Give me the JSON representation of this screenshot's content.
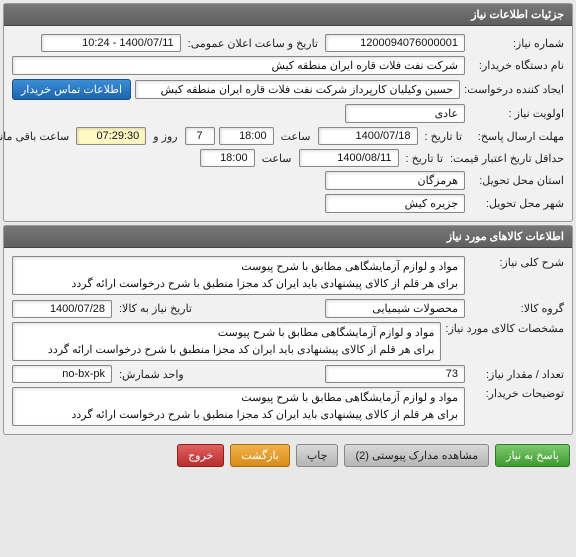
{
  "panel1": {
    "title": "جزئیات اطلاعات نیاز",
    "fields": {
      "need_no_lbl": "شماره نیاز:",
      "need_no": "1200094076000001",
      "announce_lbl": "تاریخ و ساعت اعلان عمومی:",
      "announce": "1400/07/11 - 10:24",
      "buyer_lbl": "نام دستگاه خریدار:",
      "buyer": "شرکت نفت فلات قاره ایران منطقه کیش",
      "creator_lbl": "ایجاد کننده درخواست:",
      "creator": "حسین وکیلیان کارپرداز شرکت نفت فلات قاره ایران منطقه کیش",
      "contact_btn": "اطلاعات تماس خریدار",
      "priority_lbl": "اولویت نیاز :",
      "priority": "عادی",
      "reply_deadline_lbl": "مهلت ارسال پاسخ:",
      "to_date_lbl": "تا تاریخ :",
      "reply_date": "1400/07/18",
      "time_lbl": "ساعت",
      "reply_time": "18:00",
      "days": "7",
      "days_lbl": "روز و",
      "hours": "07:29:30",
      "hours_lbl": "ساعت باقی مانده",
      "price_valid_lbl": "حداقل تاریخ اعتبار قیمت:",
      "price_valid_date": "1400/08/11",
      "price_valid_time": "18:00",
      "province_lbl": "استان محل تحویل:",
      "province": "هرمزگان",
      "city_lbl": "شهر محل تحویل:",
      "city": "جزیره کیش"
    }
  },
  "panel2": {
    "title": "اطلاعات کالاهای مورد نیاز",
    "fields": {
      "need_desc_lbl": "شرح کلی نیاز:",
      "need_desc_l1": "مواد و لوازم آزمایشگاهی مطابق با شرح پیوست",
      "need_desc_l2": "برای هر قلم از کالای پیشنهادی باید ایران کد مجزا منطبق با شرح درخواست ارائه گردد",
      "group_lbl": "گروه کالا:",
      "group": "محصولات شیمیایی",
      "need_to_date_lbl": "تاریخ نیاز به کالا:",
      "need_to_date": "1400/07/28",
      "item_spec_lbl": "مشخصات کالای مورد نیاز:",
      "item_spec_l1": "مواد و لوازم آزمایشگاهی مطابق با شرح پیوست",
      "item_spec_l2": "برای هر قلم از کالای پیشنهادی باید ایران کد مجزا منطبق با شرح درخواست ارائه گردد",
      "qty_lbl": "تعداد / مقدار نیاز:",
      "qty": "73",
      "unit_lbl": "واحد شمارش:",
      "unit": "no-bx-pk",
      "buyer_note_lbl": "توضیحات خریدار:",
      "buyer_note_l1": "مواد و لوازم آزمایشگاهی مطابق با شرح پیوست",
      "buyer_note_l2": "برای هر قلم از کالای پیشنهادی باید ایران کد مجزا منطبق با شرح درخواست ارائه گردد"
    }
  },
  "buttons": {
    "reply": "پاسخ به نیاز",
    "attachments": "مشاهده مدارک پیوستی (2)",
    "print": "چاپ",
    "back": "بازگشت",
    "exit": "خروج"
  }
}
